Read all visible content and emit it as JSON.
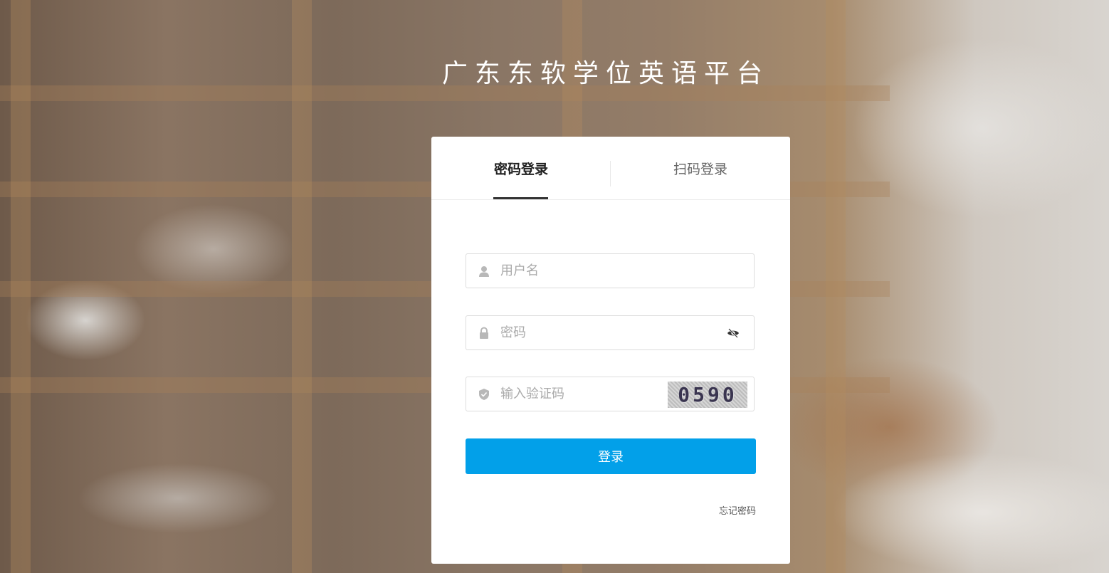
{
  "app_title": "广东东软学位英语平台",
  "tabs": [
    {
      "label": "密码登录",
      "active": true
    },
    {
      "label": "扫码登录",
      "active": false
    }
  ],
  "form": {
    "username": {
      "placeholder": "用户名",
      "value": "",
      "icon": "user-icon"
    },
    "password": {
      "placeholder": "密码",
      "value": "",
      "icon": "lock-icon",
      "toggle_icon": "eye-slash-icon"
    },
    "captcha": {
      "placeholder": "输入验证码",
      "value": "",
      "icon": "shield-check-icon",
      "image_text": "0590"
    }
  },
  "login_button": "登录",
  "forgot_password": "忘记密码",
  "colors": {
    "primary": "#02a0e9",
    "card_bg": "#ffffff",
    "title_text": "#ffffff"
  }
}
